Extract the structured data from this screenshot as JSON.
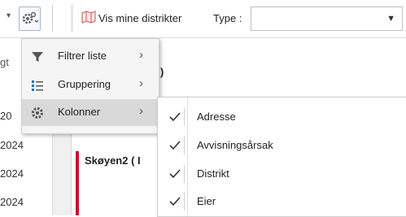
{
  "toolbar": {
    "vis_label": "Vis mine distrikter",
    "type_label": "Type :",
    "type_value": ""
  },
  "left_list": {
    "partial_header": "gt",
    "years": [
      "20",
      "2024",
      "2024",
      "2024"
    ]
  },
  "content": {
    "title_fragment": "ritt )",
    "card_title": "Skøyen2  ( I"
  },
  "menu": {
    "items": [
      {
        "label": "Filtrer liste",
        "icon": "filter-icon"
      },
      {
        "label": "Gruppering",
        "icon": "list-icon"
      },
      {
        "label": "Kolonner",
        "icon": "gear-icon"
      }
    ]
  },
  "submenu": {
    "items": [
      {
        "label": "Adresse",
        "checked": true
      },
      {
        "label": "Avvisningsårsak",
        "checked": true
      },
      {
        "label": "Distrikt",
        "checked": true
      },
      {
        "label": "Eier",
        "checked": true
      }
    ]
  },
  "colors": {
    "accent_red": "#c8102e",
    "menu_bg": "#f5f5f5",
    "active_bg": "#d9d9d9"
  }
}
